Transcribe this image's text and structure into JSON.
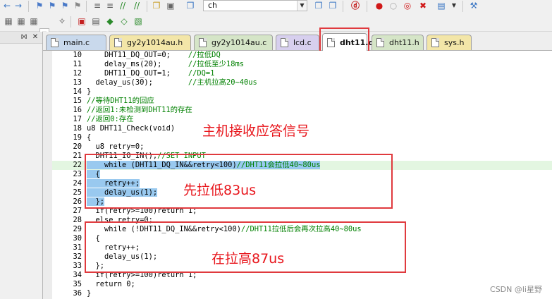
{
  "toolbar": {
    "find_text": "ch",
    "icons": [
      "back-icon",
      "forward-icon",
      "bookmark-icon",
      "bookmark-prev-icon",
      "bookmark-next-icon",
      "bookmark-clear-icon",
      "indent-icon",
      "unindent-icon",
      "comment-icon",
      "uncomment-icon",
      "find-in-files-icon",
      "debug-icon",
      "breakpoint-icon",
      "breakpoint-disable-icon",
      "breakpoint-kill-icon",
      "window-icon",
      "config-icon"
    ],
    "build_icons": [
      "translate-icon",
      "build-icon",
      "rebuild-icon",
      "target-options-icon",
      "download-icon",
      "manage-icon"
    ]
  },
  "tabs": [
    {
      "label": "main.c",
      "kind": "c",
      "active": false
    },
    {
      "label": "gy2y1014au.h",
      "kind": "h",
      "active": false
    },
    {
      "label": "gy2y1014au.c",
      "kind": "g",
      "active": false
    },
    {
      "label": "lcd.c",
      "kind": "p",
      "active": false
    },
    {
      "label": "dht11.c",
      "kind": "c",
      "active": true
    },
    {
      "label": "dht11.h",
      "kind": "g",
      "active": false
    },
    {
      "label": "sys.h",
      "kind": "h",
      "active": false
    }
  ],
  "code": [
    {
      "n": "10",
      "t": "    DHT11_DQ_OUT=0;    ",
      "c": "//拉低DQ"
    },
    {
      "n": "11",
      "t": "    delay_ms(20);      ",
      "c": "//拉低至少18ms"
    },
    {
      "n": "12",
      "t": "    DHT11_DQ_OUT=1;    ",
      "c": "//DQ=1"
    },
    {
      "n": "13",
      "t": "  delay_us(30);        ",
      "c": "//主机拉高20~40us"
    },
    {
      "n": "14",
      "t": "}",
      "c": ""
    },
    {
      "n": "15",
      "t": "",
      "c": "//等待DHT11的回应"
    },
    {
      "n": "16",
      "t": "",
      "c": "//返回1:未检测到DHT11的存在"
    },
    {
      "n": "17",
      "t": "",
      "c": "//返回0:存在"
    },
    {
      "n": "18",
      "t": "u8 DHT11_Check(void)",
      "c": ""
    },
    {
      "n": "19",
      "t": "{",
      "c": ""
    },
    {
      "n": "20",
      "t": "  u8 retry=0;",
      "c": ""
    },
    {
      "n": "21",
      "t": "  DHT11_IO_IN();",
      "c": "//SET INPUT"
    },
    {
      "n": "22",
      "t": "    while (DHT11_DQ_IN&&retry<100)",
      "c": "//DHT11会拉低40~80us"
    },
    {
      "n": "23",
      "t": "  {",
      "c": ""
    },
    {
      "n": "24",
      "t": "    retry++;",
      "c": ""
    },
    {
      "n": "25",
      "t": "    delay_us(1);",
      "c": ""
    },
    {
      "n": "26",
      "t": "  };",
      "c": ""
    },
    {
      "n": "27",
      "t": "  if(retry>=100)return 1;",
      "c": ""
    },
    {
      "n": "28",
      "t": "  else retry=0;",
      "c": ""
    },
    {
      "n": "29",
      "t": "    while (!DHT11_DQ_IN&&retry<100)",
      "c": "//DHT11拉低后会再次拉高40~80us"
    },
    {
      "n": "30",
      "t": "  {",
      "c": ""
    },
    {
      "n": "31",
      "t": "    retry++;",
      "c": ""
    },
    {
      "n": "32",
      "t": "    delay_us(1);",
      "c": ""
    },
    {
      "n": "33",
      "t": "  };",
      "c": ""
    },
    {
      "n": "34",
      "t": "  if(retry>=100)return 1;",
      "c": ""
    },
    {
      "n": "35",
      "t": "  return 0;",
      "c": ""
    },
    {
      "n": "36",
      "t": "}",
      "c": ""
    }
  ],
  "annotations": {
    "title": "主机接收应答信号",
    "low": "先拉低83us",
    "high": "在拉高87us"
  },
  "watermark": "CSDN @li星野",
  "colors": {
    "annotation_red": "#e03a3e",
    "comment_green": "#008000",
    "selection_blue": "#99c9ef"
  }
}
